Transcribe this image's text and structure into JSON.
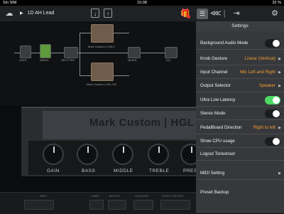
{
  "status_bar": {
    "carrier": "Sin SIM",
    "time": "15:08",
    "battery": "32 %"
  },
  "toolbar": {
    "preset_name": "1D AH Lead",
    "icons": {
      "cloud": "cloud-icon",
      "play": "play-icon",
      "download": "download-icon",
      "share": "share-icon",
      "gift": "gift-icon",
      "list": "list-icon",
      "routing": "routing-icon",
      "settings": "gear-icon"
    }
  },
  "chain": {
    "blocks": [
      "GATE",
      "2BRHT",
      "SPLITTER",
      "Mark Custom | HGL2",
      "MIXER",
      "EQ",
      "Mark Custom | HGL HD",
      "Mark Custom | HGL HD"
    ]
  },
  "amp": {
    "name": "Mark Custom | HGL",
    "knobs": [
      "GAIN",
      "BASS",
      "MIDDLE",
      "TREBLE",
      "PRES"
    ]
  },
  "bottom_nav": {
    "labels": [
      "INPUT",
      "TUNER",
      "BPM 120",
      "LIVE MODE",
      "OUTPUT SETTING",
      "OUTPUT"
    ]
  },
  "settings": {
    "title": "Settings",
    "rows": [
      {
        "label": "Background Audio Mode",
        "type": "toggle",
        "state": "off"
      },
      {
        "label": "Knob Gesture",
        "type": "select",
        "value": "Linear (Vertical)"
      },
      {
        "label": "Input Channel",
        "type": "select",
        "value": "Mix Left and Right"
      },
      {
        "label": "Output Selector",
        "type": "select",
        "value": "Speaker"
      },
      {
        "label": "Ultra Low Latency",
        "type": "toggle",
        "state": "on"
      },
      {
        "label": "Stereo Mode",
        "type": "toggle",
        "state": "off"
      },
      {
        "label": "PedalBoard Direction",
        "type": "select",
        "value": "Right to left"
      },
      {
        "label": "Show CPU usage",
        "type": "toggle",
        "state": "off"
      },
      {
        "label": "Logout Tonecloud",
        "type": "action"
      },
      {
        "label": "MIDI Setting",
        "type": "nav"
      },
      {
        "label": "Preset Backup",
        "type": "nav"
      }
    ]
  },
  "colors": {
    "accent": "#f39c33",
    "toggle_on": "#4cd964",
    "badge": "#e5322e"
  }
}
